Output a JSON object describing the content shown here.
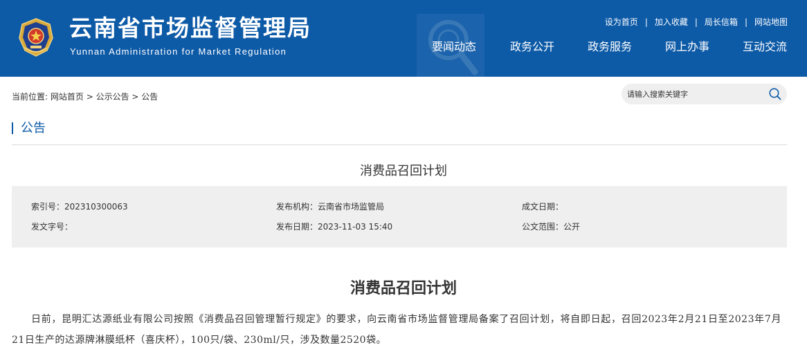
{
  "header": {
    "title": "云南省市场监督管理局",
    "subtitle": "Yunnan Administration for Market Regulation",
    "top_links": [
      "设为首页",
      "加入收藏",
      "局长信箱",
      "网站地图"
    ],
    "top_link_sep": "|",
    "nav": [
      "要闻动态",
      "政务公开",
      "政务服务",
      "网上办事",
      "互动交流"
    ]
  },
  "colors": {
    "brand_blue": "#0d5aa7",
    "panel_gray": "#efefef"
  },
  "icons": {
    "emblem": "police-emblem-icon",
    "watermark": "magnifier-watermark-icon",
    "search": "search-icon"
  },
  "breadcrumb": {
    "prefix": "当前位置:",
    "items": [
      "网站首页",
      "公示公告",
      "公告"
    ],
    "sep": " > "
  },
  "search": {
    "placeholder": "请输入搜索关键字"
  },
  "section": {
    "title": "公告"
  },
  "document": {
    "title": "消费品召回计划",
    "meta": {
      "index_no": "索引号：202310300063",
      "publisher": "发布机构：云南省市场监管局",
      "established_date": "成文日期：",
      "doc_no": "发文字号：",
      "publish_date": "发布日期：2023-11-03 15:40",
      "scope": "公文范围：公开"
    },
    "article_title": "消费品召回计划",
    "body": "日前，昆明汇达源纸业有限公司按照《消费品召回管理暂行规定》的要求，向云南省市场监督管理局备案了召回计划，将自即日起，召回2023年2月21日至2023年7月21日生产的达源牌淋膜纸杯（喜庆杯），100只/袋、230ml/只，涉及数量2520袋。"
  }
}
